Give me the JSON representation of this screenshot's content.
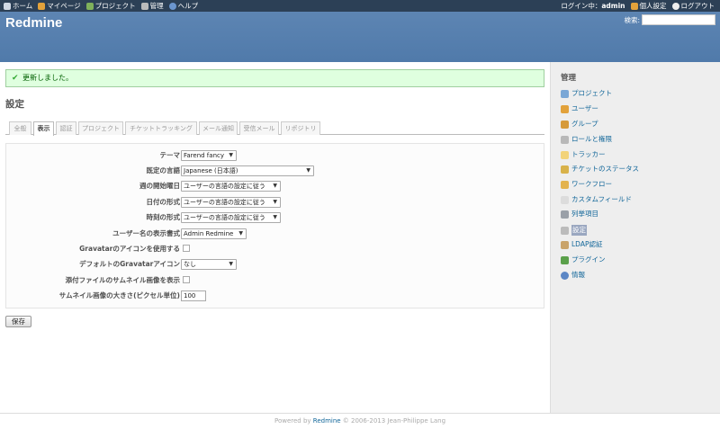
{
  "top_menu": {
    "left": [
      {
        "label": "ホーム",
        "icon": "home-icon"
      },
      {
        "label": "マイページ",
        "icon": "user-icon"
      },
      {
        "label": "プロジェクト",
        "icon": "projects-icon"
      },
      {
        "label": "管理",
        "icon": "admin-icon"
      },
      {
        "label": "ヘルプ",
        "icon": "help-icon"
      }
    ],
    "logged_in_label": "ログイン中：",
    "user": "admin",
    "my_account": "個人設定",
    "logout": "ログアウト"
  },
  "header": {
    "title": "Redmine",
    "search_label": "検索:",
    "search_value": ""
  },
  "flash": {
    "message": "更新しました。"
  },
  "page_title": "設定",
  "tabs": [
    {
      "label": "全般"
    },
    {
      "label": "表示"
    },
    {
      "label": "認証"
    },
    {
      "label": "プロジェクト"
    },
    {
      "label": "チケットトラッキング"
    },
    {
      "label": "メール通知"
    },
    {
      "label": "受信メール"
    },
    {
      "label": "リポジトリ"
    }
  ],
  "settings": [
    {
      "label": "テーマ",
      "type": "select",
      "value": "Farend fancy"
    },
    {
      "label": "既定の言語",
      "type": "select",
      "value": "Japanese (日本語)"
    },
    {
      "label": "週の開始曜日",
      "type": "select",
      "value": "ユーザーの言語の設定に従う"
    },
    {
      "label": "日付の形式",
      "type": "select",
      "value": "ユーザーの言語の設定に従う"
    },
    {
      "label": "時刻の形式",
      "type": "select",
      "value": "ユーザーの言語の設定に従う"
    },
    {
      "label": "ユーザー名の表示書式",
      "type": "select",
      "value": "Admin Redmine"
    },
    {
      "label": "Gravatarのアイコンを使用する",
      "type": "checkbox",
      "checked": false
    },
    {
      "label": "デフォルトのGravatarアイコン",
      "type": "select",
      "value": "なし"
    },
    {
      "label": "添付ファイルのサムネイル画像を表示",
      "type": "checkbox",
      "checked": false
    },
    {
      "label": "サムネイル画像の大きさ(ピクセル単位)",
      "type": "text",
      "value": "100"
    }
  ],
  "save_button": "保存",
  "sidebar": {
    "title": "管理",
    "items": [
      {
        "label": "プロジェクト",
        "icon": "projects-icon",
        "color": "#7aa7d6"
      },
      {
        "label": "ユーザー",
        "icon": "user-icon",
        "color": "#e2a23b"
      },
      {
        "label": "グループ",
        "icon": "group-icon",
        "color": "#d69a3a"
      },
      {
        "label": "ロールと権限",
        "icon": "lock-icon",
        "color": "#b8b8b8"
      },
      {
        "label": "トラッカー",
        "icon": "tracker-icon",
        "color": "#f2d37a"
      },
      {
        "label": "チケットのステータス",
        "icon": "status-icon",
        "color": "#d8b24a"
      },
      {
        "label": "ワークフロー",
        "icon": "workflow-icon",
        "color": "#e3b34f"
      },
      {
        "label": "カスタムフィールド",
        "icon": "custom-field-icon",
        "color": "#dcdcdc"
      },
      {
        "label": "列挙項目",
        "icon": "list-icon",
        "color": "#9aa0a8"
      },
      {
        "label": "設定",
        "icon": "settings-icon",
        "color": "#a4a4a4",
        "selected": true
      },
      {
        "label": "LDAP認証",
        "icon": "server-icon",
        "color": "#c9a36a"
      },
      {
        "label": "プラグイン",
        "icon": "plugin-icon",
        "color": "#5aa04a"
      },
      {
        "label": "情報",
        "icon": "info-icon",
        "color": "#5b86c5"
      }
    ]
  },
  "footer": {
    "prefix": "Powered by ",
    "link": "Redmine",
    "suffix": " © 2006-2013 Jean-Philippe Lang"
  },
  "colors": {
    "header": "#507aaa",
    "top_menu": "#2c4056",
    "flash_bg": "#dfffdf",
    "link": "#116699"
  }
}
